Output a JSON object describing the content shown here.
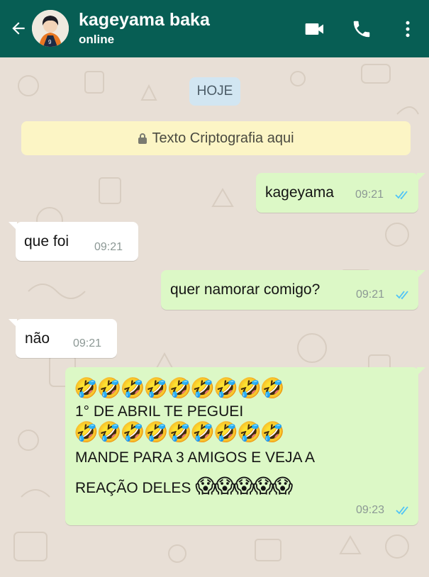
{
  "header": {
    "contact_name": "kageyama baka",
    "status": "online",
    "back_icon": "arrow-left-icon",
    "video_icon": "video-call-icon",
    "call_icon": "phone-icon",
    "menu_icon": "more-vertical-icon",
    "bar_color": "#075e54"
  },
  "chat": {
    "date_label": "HOJE",
    "encryption_banner": "Texto Criptografia aqui",
    "messages": [
      {
        "direction": "out",
        "text": "kageyama",
        "time": "09:21",
        "read": true
      },
      {
        "direction": "in",
        "text": "que foi",
        "time": "09:21"
      },
      {
        "direction": "out",
        "text": "quer namorar comigo?",
        "time": "09:21",
        "read": true
      },
      {
        "direction": "in",
        "text": "não",
        "time": "09:21"
      },
      {
        "direction": "out",
        "line1": "🤣🤣🤣🤣🤣🤣🤣🤣🤣",
        "line2": "1° DE ABRIL TE PEGUEI",
        "line3": "🤣🤣🤣🤣🤣🤣🤣🤣🤣",
        "line4": "MANDE PARA 3 AMIGOS E VEJA A",
        "line5_text": "REAÇÃO DELES",
        "line5_emoji": "😱😱😱😱😱",
        "time": "09:23",
        "read": true
      }
    ],
    "colors": {
      "outgoing": "#dcf8c6",
      "incoming": "#ffffff",
      "read_ticks": "#4fc3f7"
    }
  }
}
